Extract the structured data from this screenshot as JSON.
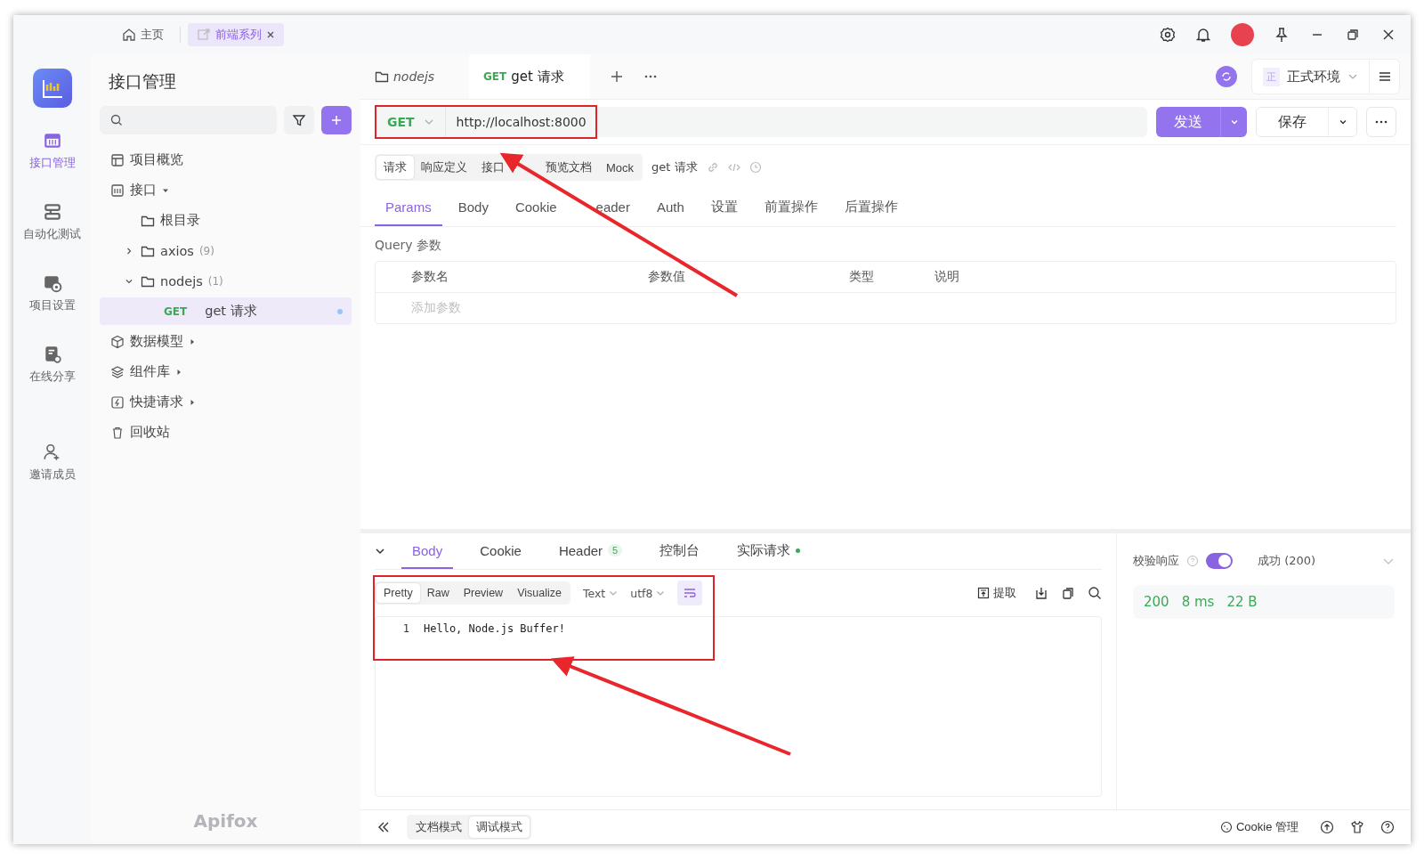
{
  "window": {
    "tabs": [
      {
        "label": "主页",
        "kind": "home",
        "selected": false,
        "closable": false
      },
      {
        "label": "前端系列",
        "kind": "project",
        "selected": true,
        "closable": true
      }
    ]
  },
  "rail": {
    "items": [
      {
        "label": "接口管理",
        "kind": "api",
        "selected": true
      },
      {
        "label": "自动化测试",
        "kind": "test",
        "selected": false
      },
      {
        "label": "项目设置",
        "kind": "settings",
        "selected": false
      },
      {
        "label": "在线分享",
        "kind": "share",
        "selected": false
      },
      {
        "label": "邀请成员",
        "kind": "invite",
        "selected": false
      }
    ]
  },
  "sidebar": {
    "title": "接口管理",
    "watermark": "Apifox",
    "tree": [
      {
        "label": "项目概览",
        "kind": "overview"
      },
      {
        "label": "接口",
        "kind": "api",
        "expanded": true,
        "children": [
          {
            "label": "根目录",
            "kind": "folder"
          },
          {
            "label": "axios",
            "count": "(9)",
            "kind": "folder",
            "expanded": false
          },
          {
            "label": "nodejs",
            "count": "(1)",
            "kind": "folder",
            "expanded": true,
            "children": [
              {
                "method": "GET",
                "label": "get 请求",
                "kind": "request",
                "selected": true
              }
            ]
          }
        ]
      },
      {
        "label": "数据模型",
        "kind": "model",
        "expanded": false
      },
      {
        "label": "组件库",
        "kind": "library",
        "expanded": false
      },
      {
        "label": "快捷请求",
        "kind": "quick",
        "expanded": false
      },
      {
        "label": "回收站",
        "kind": "trash"
      }
    ]
  },
  "main": {
    "tabs": [
      {
        "label": "nodejs",
        "kind": "folder",
        "selected": false
      },
      {
        "method": "GET",
        "label": "get 请求",
        "kind": "request",
        "selected": true
      }
    ],
    "environment": {
      "badge": "正",
      "label": "正式环境"
    },
    "request": {
      "method": "GET",
      "url": "http://localhost:8000",
      "highlighted": true,
      "send": "发送",
      "save": "保存"
    },
    "subtabs": [
      {
        "label": "请求",
        "selected": true
      },
      {
        "label": "响应定义",
        "selected": false
      },
      {
        "label": "接口",
        "selected": false
      },
      {
        "label": "预览文档",
        "selected": false
      },
      {
        "label": "Mock",
        "selected": false
      }
    ],
    "request_name": "get 请求",
    "param_tabs": [
      {
        "label": "Params",
        "selected": true
      },
      {
        "label": "Body",
        "selected": false
      },
      {
        "label": "Cookie",
        "selected": false
      },
      {
        "label": "eader",
        "selected": false
      },
      {
        "label": "Auth",
        "selected": false
      },
      {
        "label": "设置",
        "selected": false
      },
      {
        "label": "前置操作",
        "selected": false
      },
      {
        "label": "后置操作",
        "selected": false
      }
    ],
    "query_title": "Query 参数",
    "columns": [
      "参数名",
      "参数值",
      "类型",
      "说明"
    ],
    "add_placeholder": "添加参数"
  },
  "response": {
    "tabs": [
      {
        "label": "Body",
        "selected": true
      },
      {
        "label": "Cookie",
        "selected": false
      },
      {
        "label": "Header",
        "selected": false,
        "badge": "5"
      },
      {
        "label": "控制台",
        "selected": false
      },
      {
        "label": "实际请求",
        "selected": false,
        "dot": true
      }
    ],
    "formats": [
      {
        "label": "Pretty",
        "selected": true
      },
      {
        "label": "Raw",
        "selected": false
      },
      {
        "label": "Preview",
        "selected": false
      },
      {
        "label": "Visualize",
        "selected": false
      }
    ],
    "dropdowns": [
      "Text",
      "utf8"
    ],
    "wrap": true,
    "extract": "提取",
    "highlighted": true,
    "lines": [
      {
        "number": "1",
        "text": "Hello, Node.js Buffer!"
      }
    ],
    "validate_label": "校验响应",
    "validate": true,
    "status": "成功 (200)",
    "metrics": [
      "200",
      "8 ms",
      "22 B"
    ]
  },
  "footer": {
    "modes": [
      {
        "label": "文档模式",
        "selected": false
      },
      {
        "label": "调试模式",
        "selected": true
      }
    ],
    "cookie": "Cookie 管理"
  },
  "annotations": [
    {
      "kind": "arrow"
    },
    {
      "kind": "arrow"
    }
  ]
}
